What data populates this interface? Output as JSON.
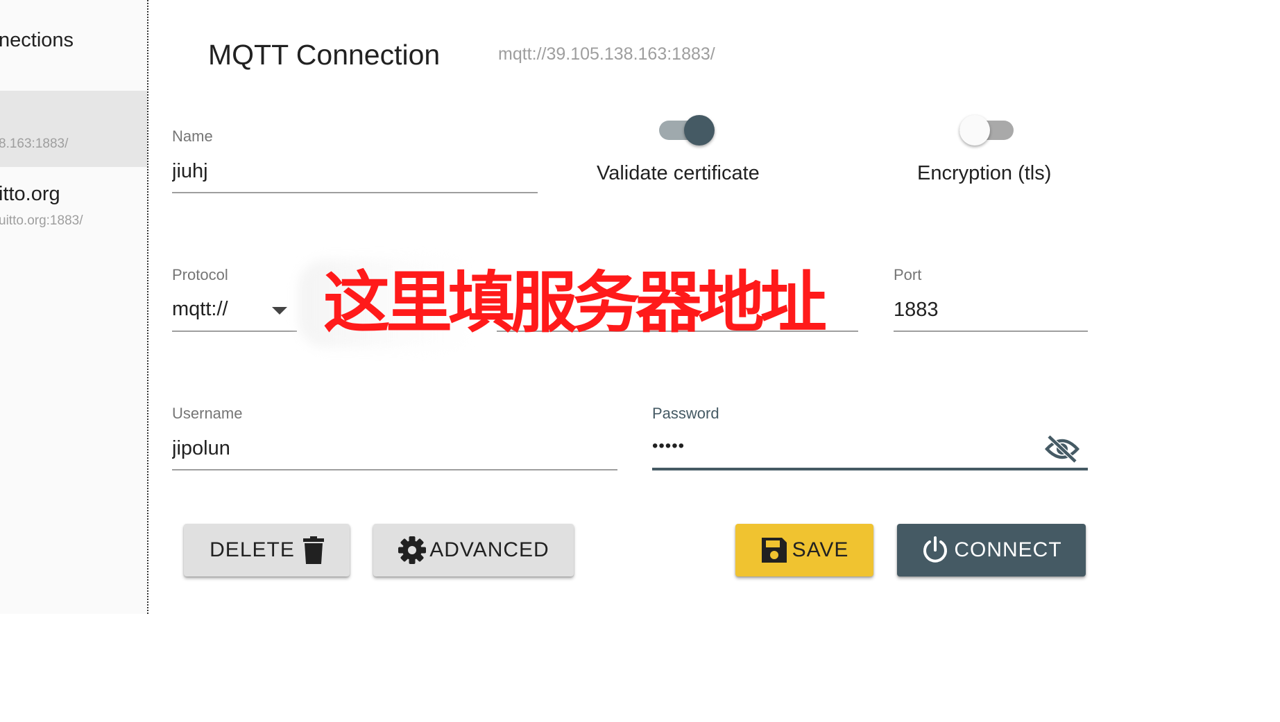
{
  "sidebar": {
    "title": "nections",
    "items": [
      {
        "name": "",
        "url": "8.163:1883/",
        "selected": true
      },
      {
        "name": "itto.org",
        "url": "uitto.org:1883/",
        "selected": false
      }
    ]
  },
  "header": {
    "title": "MQTT Connection",
    "url": "mqtt://39.105.138.163:1883/"
  },
  "form": {
    "name": {
      "label": "Name",
      "value": "jiuhj"
    },
    "validate_certificate": {
      "label": "Validate certificate",
      "on": true
    },
    "encryption": {
      "label": "Encryption (tls)",
      "on": false
    },
    "protocol": {
      "label": "Protocol",
      "value": "mqtt://"
    },
    "port": {
      "label": "Port",
      "value": "1883"
    },
    "username": {
      "label": "Username",
      "value": "jipolun"
    },
    "password": {
      "label": "Password",
      "value": "•••••"
    }
  },
  "annotation": "这里填服务器地址",
  "buttons": {
    "delete": "DELETE",
    "advanced": "ADVANCED",
    "save": "SAVE",
    "connect": "CONNECT"
  },
  "icons": {
    "delete": "trash-icon",
    "advanced": "gear-icon",
    "save": "floppy-disk-icon",
    "connect": "power-icon",
    "password_toggle": "eye-off-icon",
    "protocol_dropdown": "chevron-down-icon"
  },
  "colors": {
    "primary": "#455a64",
    "save": "#f0c330",
    "annotation": "#ff1a1a",
    "sidebar_selected": "#e6e6e6"
  }
}
